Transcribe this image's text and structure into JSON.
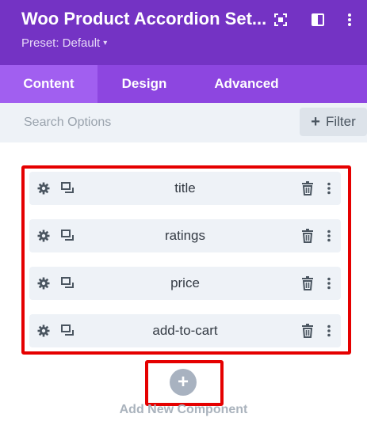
{
  "header": {
    "title": "Woo Product Accordion Set...",
    "preset_label": "Preset: Default",
    "icons": [
      "focus-icon",
      "sidebar-toggle-icon",
      "more-vertical-icon"
    ]
  },
  "tabs": [
    {
      "label": "Content",
      "active": true
    },
    {
      "label": "Design",
      "active": false
    },
    {
      "label": "Advanced",
      "active": false
    }
  ],
  "search": {
    "placeholder": "Search Options",
    "value": ""
  },
  "filter": {
    "label": "Filter"
  },
  "components": [
    {
      "label": "title"
    },
    {
      "label": "ratings"
    },
    {
      "label": "price"
    },
    {
      "label": "add-to-cart"
    }
  ],
  "add_component": {
    "label": "Add New Component"
  },
  "colors": {
    "header_bg": "#7433c4",
    "tabs_bg": "#8d46e0",
    "tab_active_bg": "#a15ff0",
    "highlight_border": "#e50000",
    "panel_bg": "#eef2f7"
  }
}
